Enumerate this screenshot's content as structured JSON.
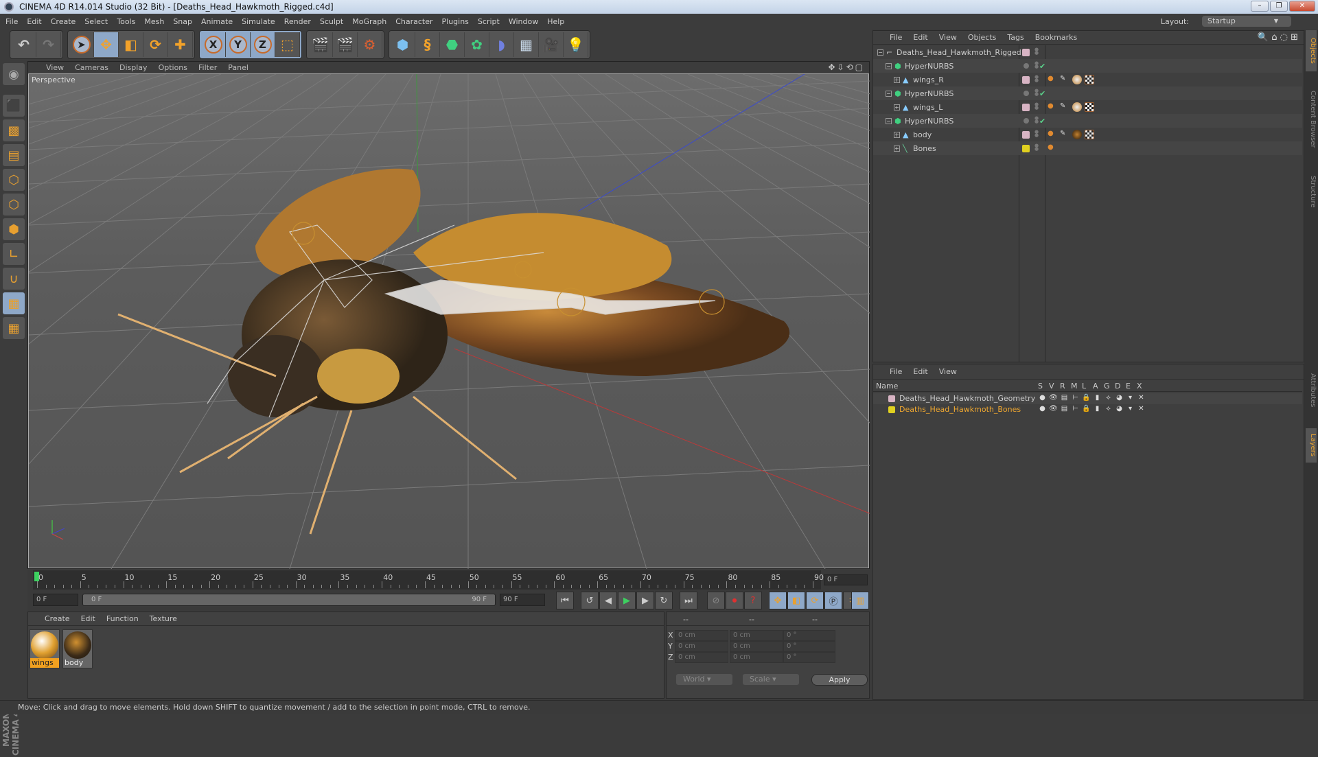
{
  "window": {
    "title": "CINEMA 4D R14.014 Studio (32 Bit) - [Deaths_Head_Hawkmoth_Rigged.c4d]",
    "minimize": "–",
    "restore": "❐",
    "close": "✕"
  },
  "menu": [
    "File",
    "Edit",
    "Create",
    "Select",
    "Tools",
    "Mesh",
    "Snap",
    "Animate",
    "Simulate",
    "Render",
    "Sculpt",
    "MoGraph",
    "Character",
    "Plugins",
    "Script",
    "Window",
    "Help"
  ],
  "layout": {
    "label": "Layout:",
    "value": "Startup"
  },
  "toolbar": {
    "groups": [
      [
        "undo",
        "redo"
      ],
      [
        "live-select",
        "move",
        "scale",
        "rotate",
        "add"
      ],
      [
        "x-axis",
        "y-axis",
        "z-axis",
        "world-coords"
      ],
      [
        "render-view",
        "render-picture",
        "render-settings"
      ],
      [
        "cube",
        "spline",
        "nurbs",
        "array",
        "deformer",
        "floor",
        "camera",
        "light"
      ]
    ],
    "axis_labels": [
      "X",
      "Y",
      "Z"
    ]
  },
  "viewport": {
    "menu": [
      "View",
      "Cameras",
      "Display",
      "Options",
      "Filter",
      "Panel"
    ],
    "camera_label": "Perspective"
  },
  "timeline": {
    "ticks": [
      0,
      5,
      10,
      15,
      20,
      25,
      30,
      35,
      40,
      45,
      50,
      55,
      60,
      65,
      70,
      75,
      80,
      85,
      90
    ],
    "current_frame": "0 F",
    "start": "0 F",
    "range_start": "0 F",
    "range_end": "90 F",
    "end": "90 F"
  },
  "materials": {
    "menu": [
      "Create",
      "Edit",
      "Function",
      "Texture"
    ],
    "items": [
      {
        "name": "wings",
        "selected": true
      },
      {
        "name": "body",
        "selected": false
      }
    ]
  },
  "coordinates": {
    "headers": [
      "--",
      "--",
      "--"
    ],
    "rows": [
      {
        "l1": "X",
        "v1": "0 cm",
        "l2": "X",
        "v2": "0 cm",
        "l3": "H",
        "v3": "0 °"
      },
      {
        "l1": "Y",
        "v1": "0 cm",
        "l2": "Y",
        "v2": "0 cm",
        "l3": "P",
        "v3": "0 °"
      },
      {
        "l1": "Z",
        "v1": "0 cm",
        "l2": "Z",
        "v2": "0 cm",
        "l3": "B",
        "v3": "0 °"
      }
    ],
    "mode": "World",
    "transform": "Scale",
    "apply": "Apply"
  },
  "status": "Move: Click and drag to move elements. Hold down SHIFT to quantize movement / add to the selection in point mode, CTRL to remove.",
  "objects": {
    "menu": [
      "File",
      "Edit",
      "View",
      "Objects",
      "Tags",
      "Bookmarks"
    ],
    "rows": [
      {
        "name": "Deaths_Head_Hawkmoth_Rigged",
        "level": 0,
        "color": "#d8b4c4",
        "check": false,
        "tags": []
      },
      {
        "name": "HyperNURBS",
        "level": 1,
        "color": "#777777",
        "check": true,
        "tags": []
      },
      {
        "name": "wings_R",
        "level": 2,
        "color": "#d8b4c4",
        "check": false,
        "tags": [
          "weight",
          "ik",
          "material-wings",
          "texture"
        ]
      },
      {
        "name": "HyperNURBS",
        "level": 1,
        "color": "#777777",
        "check": true,
        "tags": []
      },
      {
        "name": "wings_L",
        "level": 2,
        "color": "#d8b4c4",
        "check": false,
        "tags": [
          "weight",
          "ik",
          "material-wings",
          "texture"
        ]
      },
      {
        "name": "HyperNURBS",
        "level": 1,
        "color": "#777777",
        "check": true,
        "tags": []
      },
      {
        "name": "body",
        "level": 2,
        "color": "#d8b4c4",
        "check": false,
        "tags": [
          "weight",
          "ik",
          "material-body",
          "texture"
        ]
      },
      {
        "name": "Bones",
        "level": 2,
        "color": "#e0d020",
        "check": false,
        "tags": [
          "weight"
        ]
      }
    ]
  },
  "layers": {
    "menu": [
      "File",
      "Edit",
      "View"
    ],
    "columns": [
      "Name",
      "S",
      "V",
      "R",
      "M",
      "L",
      "A",
      "G",
      "D",
      "E",
      "X"
    ],
    "rows": [
      {
        "name": "Deaths_Head_Hawkmoth_Geometry",
        "color": "#d8b4c4",
        "text_color": "#cccccc"
      },
      {
        "name": "Deaths_Head_Hawkmoth_Bones",
        "color": "#e0d020",
        "text_color": "#f0a830"
      }
    ]
  },
  "right_tabs": [
    "Objects",
    "Content Browser",
    "Structure",
    "Attributes",
    "Layers"
  ],
  "branding": "MAXON CINEMA 4D"
}
